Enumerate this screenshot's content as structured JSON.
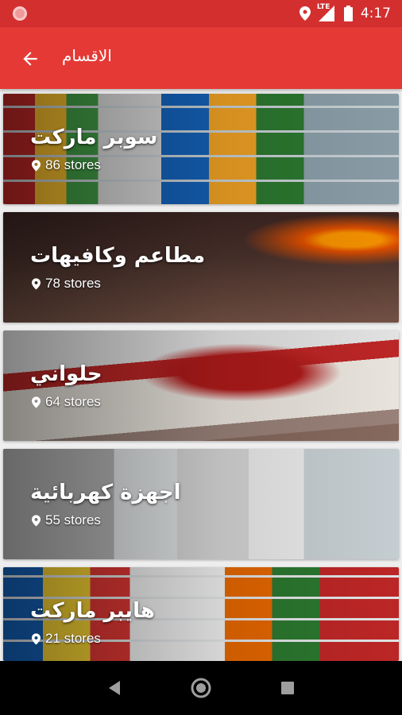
{
  "status_bar": {
    "network_label": "LTE",
    "time": "4:17"
  },
  "app_bar": {
    "title": "الاقسام",
    "back_icon": "arrow-back-icon"
  },
  "categories": [
    {
      "name": "سوبر ماركت",
      "stores": "86 stores",
      "theme": "supermarket"
    },
    {
      "name": "مطاعم وكافيهات",
      "stores": "78 stores",
      "theme": "restaurant"
    },
    {
      "name": "حلواني",
      "stores": "64 stores",
      "theme": "dessert"
    },
    {
      "name": "اجهزة كهربائية",
      "stores": "55 stores",
      "theme": "appliances"
    },
    {
      "name": "هايبر ماركت",
      "stores": "21 stores",
      "theme": "hypermarket"
    }
  ],
  "colors": {
    "status_bar": "#d32f2f",
    "app_bar": "#e53935",
    "nav_bar": "#000000"
  },
  "nav_bar": {
    "icons": [
      "back-triangle-icon",
      "home-circle-icon",
      "recents-square-icon"
    ]
  }
}
